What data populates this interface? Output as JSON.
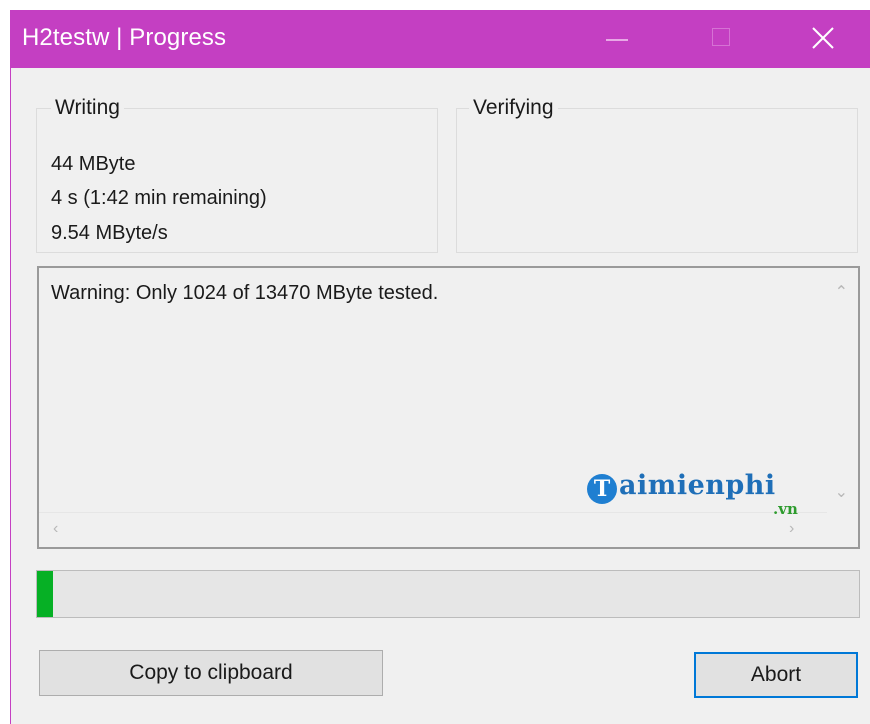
{
  "window": {
    "title": "H2testw | Progress",
    "accent_color": "#c43fc2",
    "controls": [
      "minimize-icon",
      "maximize-icon",
      "close-icon"
    ]
  },
  "writing": {
    "label": "Writing",
    "amount": "44 MByte",
    "time": "4 s (1:42 min remaining)",
    "speed": "9.54 MByte/s"
  },
  "verifying": {
    "label": "Verifying"
  },
  "log": {
    "message": "Warning: Only 1024 of 13470 MByte tested."
  },
  "watermark": {
    "initial": "T",
    "name": "aimienphi",
    "suffix": ".vn"
  },
  "progress": {
    "fraction": 0.02,
    "color": "#06b025"
  },
  "buttons": {
    "copy": "Copy to clipboard",
    "abort": "Abort"
  }
}
